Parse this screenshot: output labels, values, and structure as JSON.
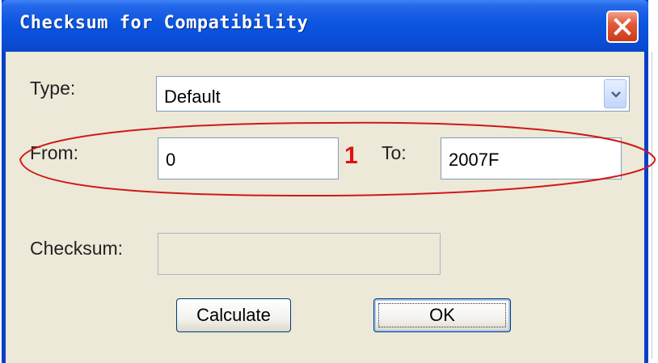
{
  "window": {
    "title": "Checksum for Compatibility",
    "close_icon": "close-icon",
    "accent": "#0a4ed8"
  },
  "form": {
    "type_label": "Type:",
    "type_value": "Default",
    "from_label": "From:",
    "from_value": "0",
    "to_label": "To:",
    "to_value": "2007F",
    "checksum_label": "Checksum:",
    "checksum_value": ""
  },
  "annotation": {
    "marker": "1",
    "color": "#e01010"
  },
  "buttons": {
    "calculate": "Calculate",
    "ok": "OK"
  }
}
